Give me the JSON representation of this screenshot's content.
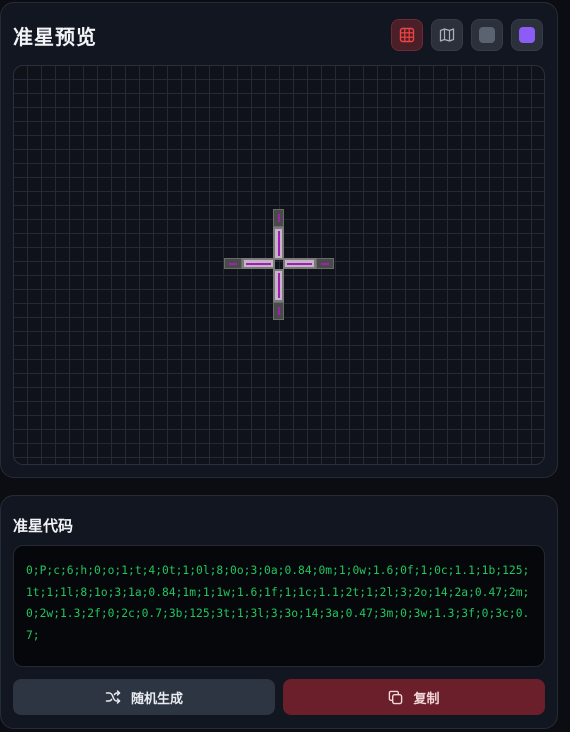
{
  "preview": {
    "title": "准星预览",
    "toolbar": [
      {
        "name": "grid-toggle-button",
        "icon": "grid-icon",
        "active": true
      },
      {
        "name": "map-background-button",
        "icon": "map-icon",
        "active": false
      },
      {
        "name": "gray-background-button",
        "icon": "gray-swatch-icon",
        "swatch": "#5c6370",
        "active": false
      },
      {
        "name": "purple-background-button",
        "icon": "purple-swatch-icon",
        "swatch": "#8b5cf6",
        "active": false
      }
    ]
  },
  "code": {
    "title": "准星代码",
    "value": "0;P;c;6;h;0;o;1;t;4;0t;1;0l;8;0o;3;0a;0.84;0m;1;0w;1.6;0f;1;0c;1.1;1b;125;1t;1;1l;8;1o;3;1a;0.84;1m;1;1w;1.6;1f;1;1c;1.1;2t;1;2l;3;2o;14;2a;0.47;2m;0;2w;1.3;2f;0;2c;0.7;3b;125;3t;1;3l;3;3o;14;3a;0.47;3m;0;3w;1.3;3f;0;3c;0.7;"
  },
  "actions": {
    "random_label": "随机生成",
    "copy_label": "复制"
  },
  "colors": {
    "accent": "#6b1f2b",
    "code_text": "#22c55e",
    "crosshair_inner_fill": "#c8b4c8",
    "crosshair_inner_border": "#7a7a7a",
    "crosshair_outer_fill": "#4a4a4a",
    "crosshair_center_line": "#a020b4"
  }
}
